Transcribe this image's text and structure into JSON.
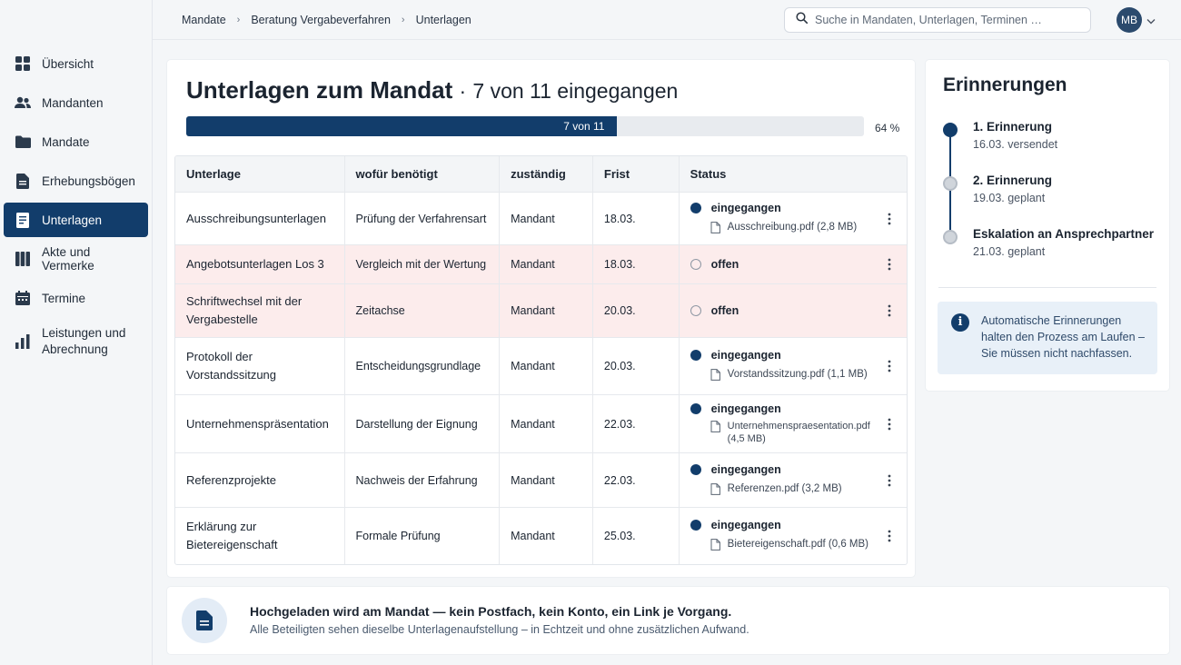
{
  "nav": {
    "items": [
      {
        "label": "Übersicht",
        "icon": "grid-icon"
      },
      {
        "label": "Mandanten",
        "icon": "users-icon"
      },
      {
        "label": "Mandate",
        "icon": "folder-icon"
      },
      {
        "label": "Erhebungsbögen",
        "icon": "form-icon"
      },
      {
        "label": "Unterlagen",
        "icon": "document-icon",
        "active": true
      },
      {
        "label": "Akte und Vermerke",
        "icon": "book-icon"
      },
      {
        "label": "Termine",
        "icon": "calendar-icon"
      },
      {
        "label": "Leistungen und Abrechnung",
        "icon": "bar-chart-icon"
      }
    ]
  },
  "breadcrumb": [
    "Mandate",
    "Beratung Vergabeverfahren",
    "Unterlagen"
  ],
  "search": {
    "placeholder": "Suche in Mandaten, Unterlagen, Terminen …"
  },
  "user": {
    "initials": "MB"
  },
  "page": {
    "title": "Unterlagen zum Mandat",
    "title_separator": "·",
    "subtitle": "7 von 11 eingegangen",
    "progress_label": "7 von 11",
    "progress_fraction": 0.636,
    "progress_percent": "64 %"
  },
  "table": {
    "headers": [
      "Unterlage",
      "wofür benötigt",
      "zuständig",
      "Frist",
      "Status"
    ],
    "rows": [
      {
        "name": "Ausschreibungsunterlagen",
        "purpose": "Prüfung der Verfahrensart",
        "owner": "Mandant",
        "due": "18.03.",
        "status": "eingegangen",
        "file": "Ausschreibung.pdf (2,8 MB)",
        "received": true
      },
      {
        "name": "Angebotsunterlagen Los 3",
        "purpose": "Vergleich mit der Wertung",
        "owner": "Mandant",
        "due": "18.03.",
        "status": "offen",
        "file": "",
        "received": false
      },
      {
        "name": "Schriftwechsel mit der Vergabestelle",
        "purpose": "Zeitachse",
        "owner": "Mandant",
        "due": "20.03.",
        "status": "offen",
        "file": "",
        "received": false
      },
      {
        "name": "Protokoll der Vorstandssitzung",
        "purpose": "Entscheidungsgrundlage",
        "owner": "Mandant",
        "due": "20.03.",
        "status": "eingegangen",
        "file": "Vorstandssitzung.pdf (1,1 MB)",
        "received": true
      },
      {
        "name": "Unternehmenspräsentation",
        "purpose": "Darstellung der Eignung",
        "owner": "Mandant",
        "due": "22.03.",
        "status": "eingegangen",
        "file": "Unternehmenspraesentation.pdf (4,5 MB)",
        "received": true
      },
      {
        "name": "Referenzprojekte",
        "purpose": "Nachweis der Erfahrung",
        "owner": "Mandant",
        "due": "22.03.",
        "status": "eingegangen",
        "file": "Referenzen.pdf (3,2 MB)",
        "received": true
      },
      {
        "name": "Erklärung zur Bietereigenschaft",
        "purpose": "Formale Prüfung",
        "owner": "Mandant",
        "due": "25.03.",
        "status": "eingegangen",
        "file": "Bietereigenschaft.pdf (0,6 MB)",
        "received": true
      }
    ]
  },
  "reminders": {
    "title": "Erinnerungen",
    "items": [
      {
        "name": "1. Erinnerung",
        "sub": "16.03. versendet",
        "done": true
      },
      {
        "name": "2. Erinnerung",
        "sub": "19.03. geplant",
        "done": false
      },
      {
        "name": "Eskalation an Ansprechpartner",
        "sub": "21.03. geplant",
        "done": false
      }
    ],
    "info": "Automatische Erinnerungen halten den Prozess am Laufen – Sie müssen nicht nachfassen."
  },
  "banner": {
    "headline": "Hochgeladen wird am Mandat — kein Postfach, kein Konto, ein Link je Vorgang.",
    "sub": "Alle Beteiligten sehen dieselbe Unterlagenaufstellung – in Echtzeit und ohne zusätzlichen Aufwand."
  },
  "colors": {
    "accent": "#123d6b",
    "open_row": "#fcecec",
    "info_bg": "#e8f0f8"
  }
}
